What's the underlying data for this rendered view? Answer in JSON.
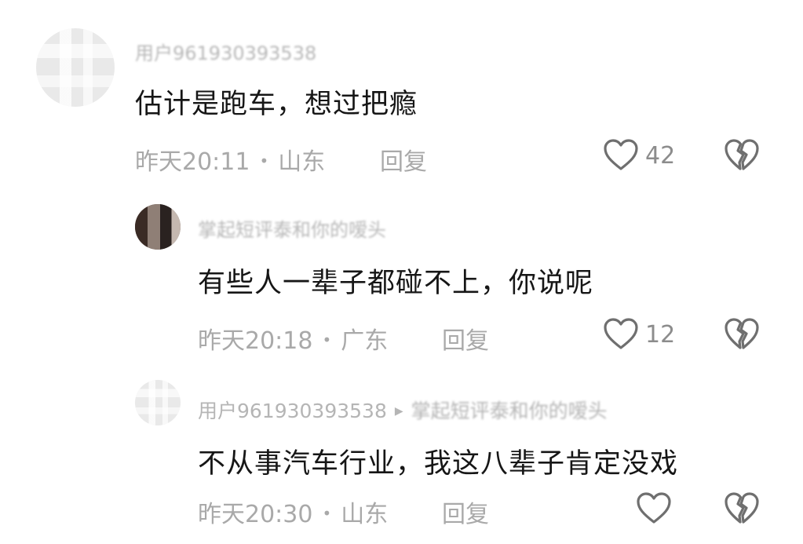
{
  "comments": [
    {
      "username": "用户961930393538",
      "text": "估计是跑车，想过把瘾",
      "time": "昨天20:11",
      "location": "山东",
      "reply_label": "回复",
      "likes": "42"
    },
    {
      "username": "掌起短评泰和你的嗳头",
      "text": "有些人一辈子都碰不上，你说呢",
      "time": "昨天20:18",
      "location": "广东",
      "reply_label": "回复",
      "likes": "12"
    },
    {
      "username": "用户961930393538",
      "reply_to": "掌起短评泰和你的嗳头",
      "text": "不从事汽车行业，我这八辈子肯定没戏",
      "time": "昨天20:30",
      "location": "山东",
      "reply_label": "回复",
      "likes": ""
    }
  ],
  "icons": {
    "like": "heart-outline-icon",
    "dislike": "broken-heart-icon",
    "reply_arrow": "triangle-right-icon"
  },
  "colors": {
    "text": "#161616",
    "meta": "#a9a9a9",
    "icon": "#6f6f6f"
  }
}
